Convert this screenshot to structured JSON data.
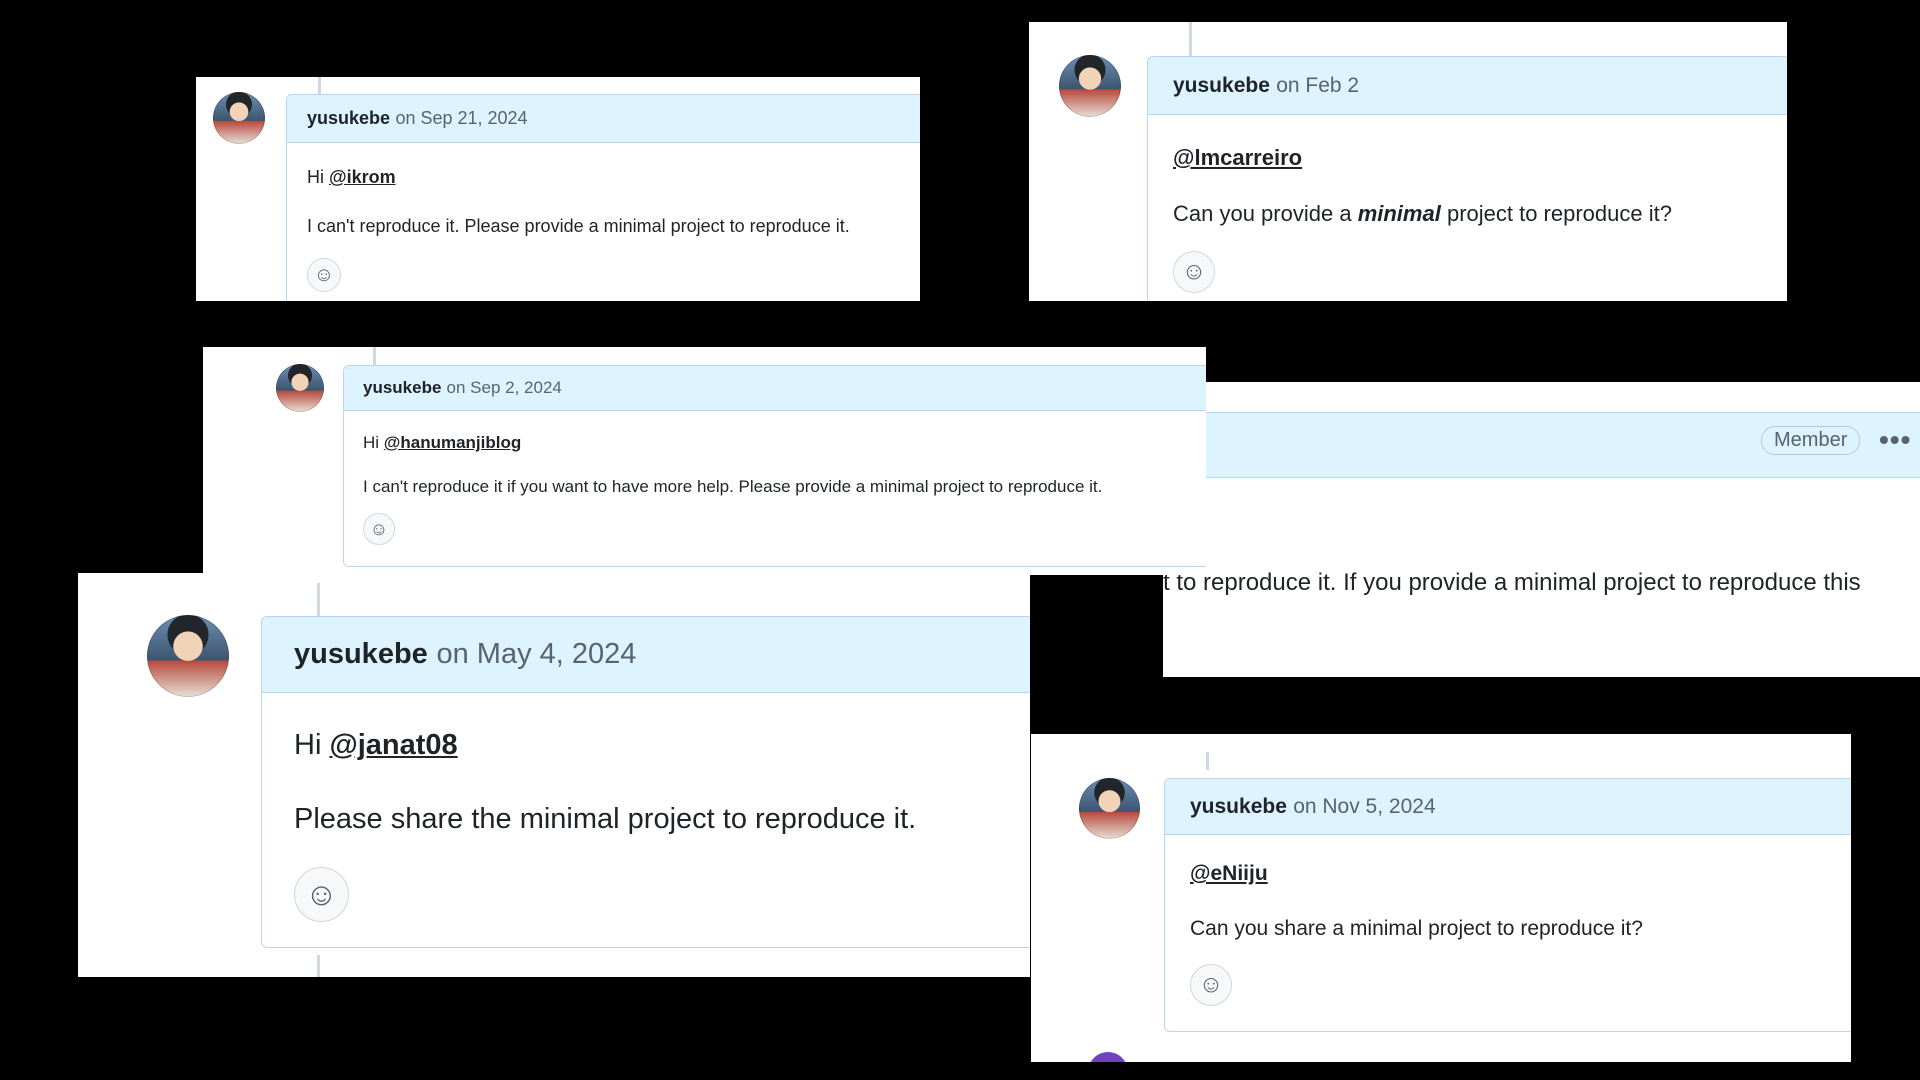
{
  "comments": {
    "c1": {
      "author": "yusukebe",
      "date": "on Sep 21, 2024",
      "greeting": "Hi",
      "mention": "@ikrom",
      "body": "I can't reproduce it. Please provide a minimal project to reproduce it."
    },
    "c2": {
      "author": "yusukebe",
      "date": "on Feb 2",
      "mention": "@lmcarreiro",
      "body_pre": "Can you provide a",
      "body_em": "minimal",
      "body_post": "project to reproduce it?"
    },
    "c3": {
      "author": "yusukebe",
      "date": "on Sep 2, 2024",
      "greeting": "Hi",
      "mention": "@hanumanjiblog",
      "body": "I can't reproduce it if you want to have more help. Please provide a minimal project to reproduce it."
    },
    "c4": {
      "badge": "Member",
      "menu": "•••",
      "body": "t to reproduce it. If you provide a minimal project to reproduce this"
    },
    "c5": {
      "author": "yusukebe",
      "date": "on May 4, 2024",
      "greeting": "Hi",
      "mention": "@janat08",
      "body": "Please share the minimal project to reproduce it."
    },
    "c6": {
      "author": "yusukebe",
      "date": "on Nov 5, 2024",
      "mention": "@eNiiju",
      "body": "Can you share a minimal project to reproduce it?"
    }
  },
  "icons": {
    "emoji": "smiley-icon",
    "avatar": "avatar-photo"
  },
  "colors": {
    "header_bg": "#ddf4ff",
    "border": "#b6d7f2",
    "background": "#000000"
  }
}
